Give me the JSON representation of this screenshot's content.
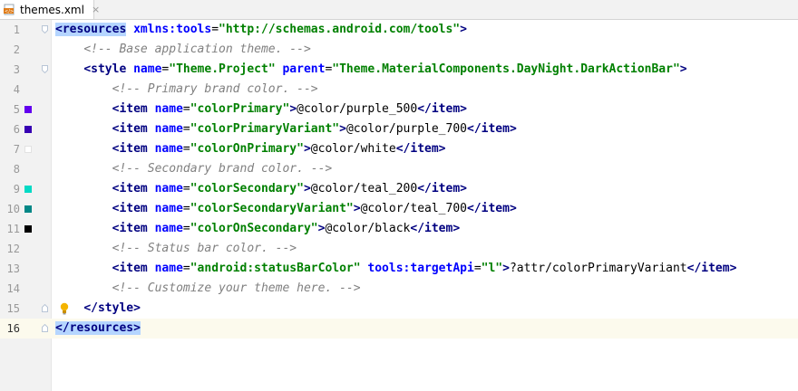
{
  "tab": {
    "filename": "themes.xml",
    "close_glyph": "×",
    "icon": "xml-file-icon"
  },
  "accent": {
    "fold_marker": "#b8c5d6",
    "current_line": "#fcfaed",
    "match_highlight": "#b5d5ff"
  },
  "lines": [
    {
      "num": "1",
      "swatch": null,
      "fold": "open",
      "tokens": [
        {
          "t": "tag",
          "v": "<resources",
          "hl": true
        },
        {
          "t": "plain",
          "v": " "
        },
        {
          "t": "attr",
          "v": "xmlns:tools"
        },
        {
          "t": "plain",
          "v": "="
        },
        {
          "t": "val",
          "v": "\"http://schemas.android.com/tools\""
        },
        {
          "t": "tag",
          "v": ">"
        }
      ]
    },
    {
      "num": "2",
      "swatch": null,
      "fold": null,
      "tokens": [
        {
          "t": "plain",
          "v": "    "
        },
        {
          "t": "cmt",
          "v": "<!-- Base application theme. -->"
        }
      ]
    },
    {
      "num": "3",
      "swatch": null,
      "fold": "open",
      "tokens": [
        {
          "t": "plain",
          "v": "    "
        },
        {
          "t": "tag",
          "v": "<style "
        },
        {
          "t": "attr",
          "v": "name"
        },
        {
          "t": "plain",
          "v": "="
        },
        {
          "t": "val",
          "v": "\"Theme.Project\""
        },
        {
          "t": "plain",
          "v": " "
        },
        {
          "t": "attr",
          "v": "parent"
        },
        {
          "t": "plain",
          "v": "="
        },
        {
          "t": "val",
          "v": "\"Theme.MaterialComponents.DayNight.DarkActionBar\""
        },
        {
          "t": "tag",
          "v": ">"
        }
      ]
    },
    {
      "num": "4",
      "swatch": null,
      "fold": null,
      "tokens": [
        {
          "t": "plain",
          "v": "        "
        },
        {
          "t": "cmt",
          "v": "<!-- Primary brand color. -->"
        }
      ]
    },
    {
      "num": "5",
      "swatch": "#6200ee",
      "fold": null,
      "tokens": [
        {
          "t": "plain",
          "v": "        "
        },
        {
          "t": "tag",
          "v": "<item "
        },
        {
          "t": "attr",
          "v": "name"
        },
        {
          "t": "plain",
          "v": "="
        },
        {
          "t": "val",
          "v": "\"colorPrimary\""
        },
        {
          "t": "tag",
          "v": ">"
        },
        {
          "t": "plain",
          "v": "@color/purple_500"
        },
        {
          "t": "tag",
          "v": "</item>"
        }
      ]
    },
    {
      "num": "6",
      "swatch": "#3700b3",
      "fold": null,
      "tokens": [
        {
          "t": "plain",
          "v": "        "
        },
        {
          "t": "tag",
          "v": "<item "
        },
        {
          "t": "attr",
          "v": "name"
        },
        {
          "t": "plain",
          "v": "="
        },
        {
          "t": "val",
          "v": "\"colorPrimaryVariant\""
        },
        {
          "t": "tag",
          "v": ">"
        },
        {
          "t": "plain",
          "v": "@color/purple_700"
        },
        {
          "t": "tag",
          "v": "</item>"
        }
      ]
    },
    {
      "num": "7",
      "swatch": "#ffffff",
      "fold": null,
      "tokens": [
        {
          "t": "plain",
          "v": "        "
        },
        {
          "t": "tag",
          "v": "<item "
        },
        {
          "t": "attr",
          "v": "name"
        },
        {
          "t": "plain",
          "v": "="
        },
        {
          "t": "val",
          "v": "\"colorOnPrimary\""
        },
        {
          "t": "tag",
          "v": ">"
        },
        {
          "t": "plain",
          "v": "@color/white"
        },
        {
          "t": "tag",
          "v": "</item>"
        }
      ]
    },
    {
      "num": "8",
      "swatch": null,
      "fold": null,
      "tokens": [
        {
          "t": "plain",
          "v": "        "
        },
        {
          "t": "cmt",
          "v": "<!-- Secondary brand color. -->"
        }
      ]
    },
    {
      "num": "9",
      "swatch": "#03dac5",
      "fold": null,
      "tokens": [
        {
          "t": "plain",
          "v": "        "
        },
        {
          "t": "tag",
          "v": "<item "
        },
        {
          "t": "attr",
          "v": "name"
        },
        {
          "t": "plain",
          "v": "="
        },
        {
          "t": "val",
          "v": "\"colorSecondary\""
        },
        {
          "t": "tag",
          "v": ">"
        },
        {
          "t": "plain",
          "v": "@color/teal_200"
        },
        {
          "t": "tag",
          "v": "</item>"
        }
      ]
    },
    {
      "num": "10",
      "swatch": "#018786",
      "fold": null,
      "tokens": [
        {
          "t": "plain",
          "v": "        "
        },
        {
          "t": "tag",
          "v": "<item "
        },
        {
          "t": "attr",
          "v": "name"
        },
        {
          "t": "plain",
          "v": "="
        },
        {
          "t": "val",
          "v": "\"colorSecondaryVariant\""
        },
        {
          "t": "tag",
          "v": ">"
        },
        {
          "t": "plain",
          "v": "@color/teal_700"
        },
        {
          "t": "tag",
          "v": "</item>"
        }
      ]
    },
    {
      "num": "11",
      "swatch": "#000000",
      "fold": null,
      "tokens": [
        {
          "t": "plain",
          "v": "        "
        },
        {
          "t": "tag",
          "v": "<item "
        },
        {
          "t": "attr",
          "v": "name"
        },
        {
          "t": "plain",
          "v": "="
        },
        {
          "t": "val",
          "v": "\"colorOnSecondary\""
        },
        {
          "t": "tag",
          "v": ">"
        },
        {
          "t": "plain",
          "v": "@color/black"
        },
        {
          "t": "tag",
          "v": "</item>"
        }
      ]
    },
    {
      "num": "12",
      "swatch": null,
      "fold": null,
      "tokens": [
        {
          "t": "plain",
          "v": "        "
        },
        {
          "t": "cmt",
          "v": "<!-- Status bar color. -->"
        }
      ]
    },
    {
      "num": "13",
      "swatch": null,
      "fold": null,
      "tokens": [
        {
          "t": "plain",
          "v": "        "
        },
        {
          "t": "tag",
          "v": "<item "
        },
        {
          "t": "attr",
          "v": "name"
        },
        {
          "t": "plain",
          "v": "="
        },
        {
          "t": "val",
          "v": "\"android:statusBarColor\""
        },
        {
          "t": "plain",
          "v": " "
        },
        {
          "t": "attr",
          "v": "tools:targetApi"
        },
        {
          "t": "plain",
          "v": "="
        },
        {
          "t": "val",
          "v": "\"l\""
        },
        {
          "t": "tag",
          "v": ">"
        },
        {
          "t": "plain",
          "v": "?attr/colorPrimaryVariant"
        },
        {
          "t": "tag",
          "v": "</item>"
        }
      ]
    },
    {
      "num": "14",
      "swatch": null,
      "fold": null,
      "tokens": [
        {
          "t": "plain",
          "v": "        "
        },
        {
          "t": "cmt",
          "v": "<!-- Customize your theme here. -->"
        }
      ]
    },
    {
      "num": "15",
      "swatch": null,
      "fold": "close",
      "bulb": true,
      "tokens": [
        {
          "t": "plain",
          "v": "    "
        },
        {
          "t": "tag",
          "v": "</style>"
        }
      ]
    },
    {
      "num": "16",
      "swatch": null,
      "fold": "close",
      "current": true,
      "tokens": [
        {
          "t": "tag",
          "v": "</resources>",
          "hl": true
        }
      ]
    }
  ]
}
